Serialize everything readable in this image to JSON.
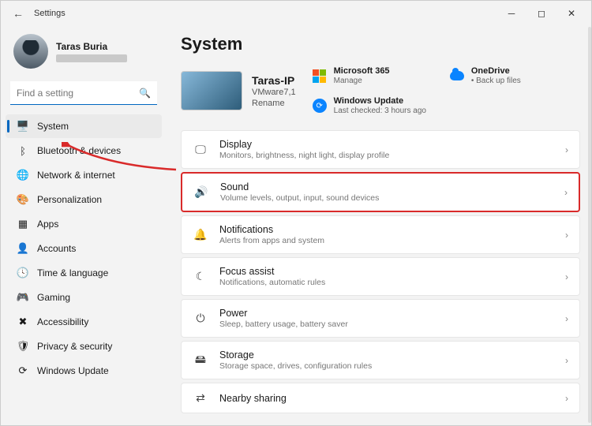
{
  "titlebar": {
    "app_name": "Settings"
  },
  "profile": {
    "display_name": "Taras Buria"
  },
  "search": {
    "placeholder": "Find a setting"
  },
  "sidebar": {
    "items": [
      {
        "label": "System",
        "icon": "🖥️",
        "name": "sidebar-item-system",
        "active": true
      },
      {
        "label": "Bluetooth & devices",
        "icon": "ᛒ",
        "name": "sidebar-item-bluetooth"
      },
      {
        "label": "Network & internet",
        "icon": "🌐",
        "name": "sidebar-item-network"
      },
      {
        "label": "Personalization",
        "icon": "🎨",
        "name": "sidebar-item-personalization"
      },
      {
        "label": "Apps",
        "icon": "▦",
        "name": "sidebar-item-apps"
      },
      {
        "label": "Accounts",
        "icon": "👤",
        "name": "sidebar-item-accounts"
      },
      {
        "label": "Time & language",
        "icon": "🕓",
        "name": "sidebar-item-time-language"
      },
      {
        "label": "Gaming",
        "icon": "🎮",
        "name": "sidebar-item-gaming"
      },
      {
        "label": "Accessibility",
        "icon": "✖",
        "name": "sidebar-item-accessibility"
      },
      {
        "label": "Privacy & security",
        "icon": "🛡",
        "name": "sidebar-item-privacy"
      },
      {
        "label": "Windows Update",
        "icon": "⟳",
        "name": "sidebar-item-windows-update"
      }
    ]
  },
  "main": {
    "heading": "System",
    "pc": {
      "name": "Taras-IP",
      "model": "VMware7,1",
      "rename_label": "Rename"
    },
    "quick": {
      "m365": {
        "title": "Microsoft 365",
        "sub": "Manage"
      },
      "onedrive": {
        "title": "OneDrive",
        "sub": "• Back up files"
      },
      "wu": {
        "title": "Windows Update",
        "sub": "Last checked: 3 hours ago"
      }
    },
    "settings": [
      {
        "name": "setting-display",
        "icon": "🖵",
        "title": "Display",
        "sub": "Monitors, brightness, night light, display profile"
      },
      {
        "name": "setting-sound",
        "icon": "🔊",
        "title": "Sound",
        "sub": "Volume levels, output, input, sound devices",
        "highlight": true
      },
      {
        "name": "setting-notifications",
        "icon": "🔔",
        "title": "Notifications",
        "sub": "Alerts from apps and system"
      },
      {
        "name": "setting-focus-assist",
        "icon": "☾",
        "title": "Focus assist",
        "sub": "Notifications, automatic rules"
      },
      {
        "name": "setting-power",
        "icon": "⏻",
        "title": "Power",
        "sub": "Sleep, battery usage, battery saver"
      },
      {
        "name": "setting-storage",
        "icon": "🖴",
        "title": "Storage",
        "sub": "Storage space, drives, configuration rules"
      },
      {
        "name": "setting-nearby-sharing",
        "icon": "⇄",
        "title": "Nearby sharing",
        "sub": ""
      }
    ]
  }
}
